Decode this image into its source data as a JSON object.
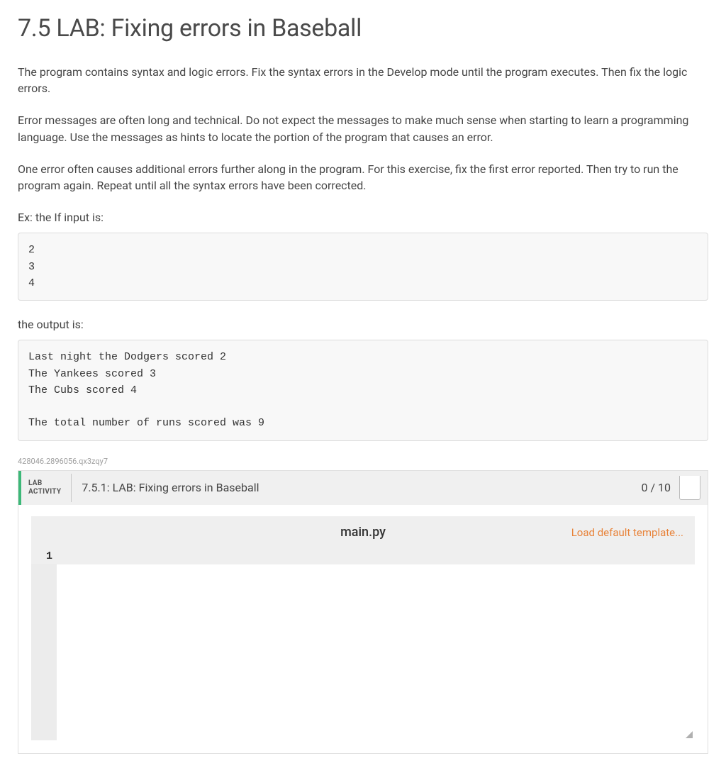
{
  "title": "7.5 LAB: Fixing errors in Baseball",
  "paragraphs": {
    "p1": "The program contains syntax and logic errors. Fix the syntax errors in the Develop mode until the program executes. Then fix the logic errors.",
    "p2": "Error messages are often long and technical. Do not expect the messages to make much sense when starting to learn a programming language. Use the messages as hints to locate the portion of the program that causes an error.",
    "p3": "One error often causes additional errors further along in the program. For this exercise, fix the first error reported. Then try to run the program again. Repeat until all the syntax errors have been corrected.",
    "p4": "Ex: the If input is:",
    "p5": "the output is:"
  },
  "input_block": "2\n3\n4",
  "output_block": "Last night the Dodgers scored 2\nThe Yankees scored 3\nThe Cubs scored 4\n\nThe total number of runs scored was 9",
  "hash": "428046.2896056.qx3zqy7",
  "lab": {
    "activity_label_line1": "LAB",
    "activity_label_line2": "ACTIVITY",
    "lab_title": "7.5.1: LAB: Fixing errors in Baseball",
    "score": "0 / 10",
    "filename": "main.py",
    "load_template": "Load default template...",
    "line_number": "1",
    "code_content": ""
  }
}
